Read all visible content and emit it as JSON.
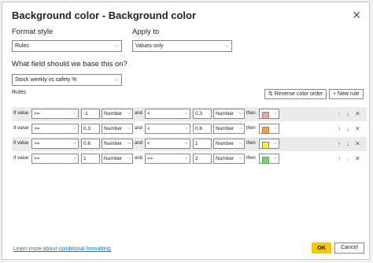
{
  "dialog": {
    "title": "Background color - Background color",
    "close_icon": "close-icon"
  },
  "format_style": {
    "label": "Format style",
    "value": "Rules"
  },
  "apply_to": {
    "label": "Apply to",
    "value": "Values only"
  },
  "base_field": {
    "label": "What field should we base this on?",
    "value": "Stock weekly vs safety %"
  },
  "rules_label": "Rules",
  "toolbar": {
    "reverse_label": "Reverse color order",
    "new_rule_label": "New rule",
    "reverse_icon": "swap-icon",
    "plus_icon": "plus-icon"
  },
  "rules": [
    {
      "if_label": "If value",
      "op1": ">=",
      "val1": "-1",
      "type1": "Number",
      "and_label": "and",
      "op2": "<",
      "val2": "0.3",
      "type2": "Number",
      "then_label": "then",
      "color": "#f4a0a0"
    },
    {
      "if_label": "If value",
      "op1": ">=",
      "val1": "0.3",
      "type1": "Number",
      "and_label": "and",
      "op2": "<",
      "val2": "0.6",
      "type2": "Number",
      "then_label": "then",
      "color": "#f4a040"
    },
    {
      "if_label": "If value",
      "op1": ">=",
      "val1": "0.6",
      "type1": "Number",
      "and_label": "and",
      "op2": "<",
      "val2": "1",
      "type2": "Number",
      "then_label": "then",
      "color": "#f6f03a"
    },
    {
      "if_label": "If value",
      "op1": ">=",
      "val1": "1",
      "type1": "Number",
      "and_label": "and",
      "op2": "<=",
      "val2": "2",
      "type2": "Number",
      "then_label": "then",
      "color": "#66dd66"
    }
  ],
  "footer": {
    "link": "Learn more about conditional formatting",
    "ok": "OK",
    "cancel": "Cancel"
  },
  "colors": {
    "accent": "#f2c811",
    "link": "#0078d4"
  }
}
